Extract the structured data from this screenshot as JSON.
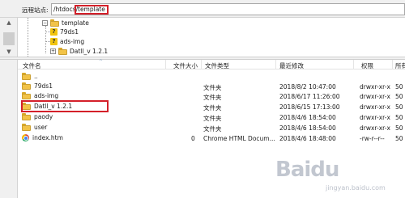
{
  "path_bar": {
    "label": "远程站点:",
    "path_prefix": "/htdocs/",
    "path_highlight": "template"
  },
  "tree": {
    "items": [
      {
        "label": "template",
        "icon": "folder-icon",
        "expander": "⊟"
      },
      {
        "label": "79ds1",
        "icon": "question-folder-icon"
      },
      {
        "label": "ads-img",
        "icon": "question-folder-icon"
      },
      {
        "label": "Datll_v 1.2.1",
        "icon": "folder-icon",
        "expander": "⊞"
      }
    ]
  },
  "file_list": {
    "columns": [
      "文件名",
      "文件大小",
      "文件类型",
      "最近修改",
      "权限",
      "所有"
    ],
    "rows": [
      {
        "name": "..",
        "size": "",
        "type": "",
        "modified": "",
        "perms": "",
        "owner": "",
        "icon": "folder-icon"
      },
      {
        "name": "79ds1",
        "size": "",
        "type": "文件夹",
        "modified": "2018/8/2 10:47:00",
        "perms": "drwxr-xr-x",
        "owner": "50",
        "icon": "folder-icon"
      },
      {
        "name": "ads-img",
        "size": "",
        "type": "文件夹",
        "modified": "2018/6/17 11:26:00",
        "perms": "drwxr-xr-x",
        "owner": "50",
        "icon": "folder-icon"
      },
      {
        "name": "Datll_v 1.2.1",
        "size": "",
        "type": "文件夹",
        "modified": "2018/6/15 17:13:00",
        "perms": "drwxr-xr-x",
        "owner": "50",
        "icon": "folder-icon"
      },
      {
        "name": "paody",
        "size": "",
        "type": "文件夹",
        "modified": "2018/4/6 18:54:00",
        "perms": "drwxr-xr-x",
        "owner": "50",
        "icon": "folder-icon"
      },
      {
        "name": "user",
        "size": "",
        "type": "文件夹",
        "modified": "2018/4/6 18:54:00",
        "perms": "drwxr-xr-x",
        "owner": "50",
        "icon": "folder-icon"
      },
      {
        "name": "index.htm",
        "size": "0",
        "type": "Chrome HTML Docum...",
        "modified": "2018/4/6 18:48:00",
        "perms": "-rw-r--r--",
        "owner": "50",
        "icon": "chrome-file-icon"
      }
    ]
  },
  "watermark": {
    "logo": "Baidu",
    "sub": "jingyan.baidu.com"
  },
  "colors": {
    "highlight": "#d4202a",
    "folder": "#f2c347"
  }
}
